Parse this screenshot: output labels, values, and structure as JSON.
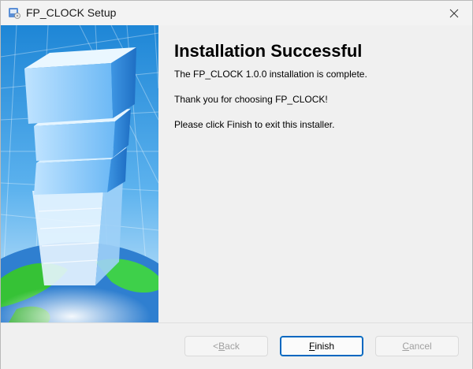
{
  "window": {
    "title": "FP_CLOCK Setup"
  },
  "page": {
    "heading": "Installation Successful",
    "line1": "The FP_CLOCK 1.0.0 installation is complete.",
    "line2": "Thank you for choosing FP_CLOCK!",
    "line3": "Please click Finish to exit this installer."
  },
  "buttons": {
    "back": {
      "mnemonic": "B",
      "rest": "ack",
      "prefix": "< ",
      "enabled": false
    },
    "finish": {
      "mnemonic": "F",
      "rest": "inish",
      "prefix": "",
      "enabled": true,
      "default": true
    },
    "cancel": {
      "mnemonic": "C",
      "rest": "ancel",
      "prefix": "",
      "enabled": false
    }
  },
  "icons": {
    "app": "installer-icon",
    "close": "close-icon",
    "banner": "tower-globe-banner"
  },
  "colors": {
    "accent": "#0067c0",
    "banner_sky": "#1a8ad8",
    "globe_land": "#3fc43f",
    "disabled_text": "#a0a0a0"
  }
}
